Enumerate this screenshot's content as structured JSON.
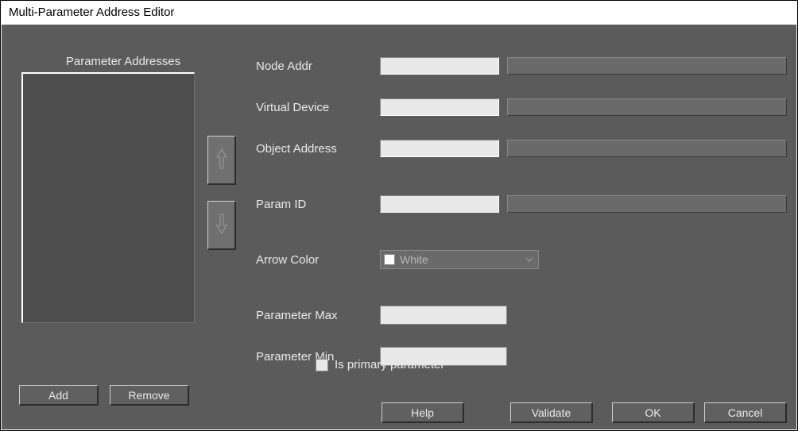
{
  "window": {
    "title": "Multi-Parameter Address Editor"
  },
  "sidebar": {
    "title": "Parameter Addresses",
    "add_label": "Add",
    "remove_label": "Remove"
  },
  "form": {
    "node_addr": {
      "label": "Node Addr",
      "value": "",
      "display": ""
    },
    "virtual_device": {
      "label": "Virtual Device",
      "value": "",
      "display": ""
    },
    "object_address": {
      "label": "Object Address",
      "value": "",
      "display": ""
    },
    "param_id": {
      "label": "Param ID",
      "value": "",
      "display": ""
    },
    "arrow_color": {
      "label": "Arrow Color",
      "selected": "White",
      "swatch": "#ffffff"
    },
    "param_max": {
      "label": "Parameter Max",
      "value": ""
    },
    "param_min": {
      "label": "Parameter Min",
      "value": ""
    },
    "is_primary": {
      "label": "Is primary parameter",
      "checked": false
    }
  },
  "buttons": {
    "help": "Help",
    "validate": "Validate",
    "ok": "OK",
    "cancel": "Cancel"
  }
}
